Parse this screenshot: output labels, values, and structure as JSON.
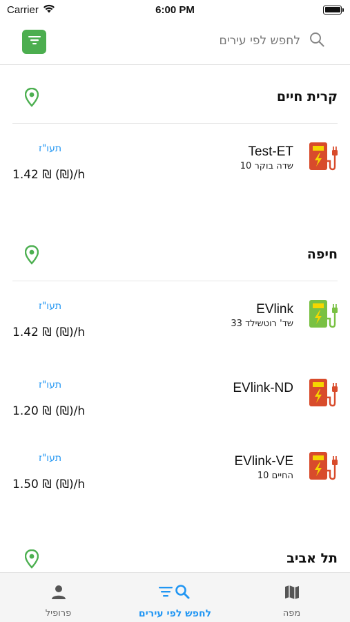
{
  "status_bar": {
    "carrier": "Carrier",
    "time": "6:00 PM"
  },
  "search": {
    "placeholder": "לחפש לפי עירים"
  },
  "cities": [
    {
      "name": "קרית חיים",
      "stations": [
        {
          "name": "Test-ET",
          "address": "שדה בוקר 10",
          "link": "תעו\"ז",
          "price": "1.42 ₪ (₪)/h",
          "status": "busy",
          "color": "#d84b2b"
        }
      ]
    },
    {
      "name": "חיפה",
      "stations": [
        {
          "name": "EVlink",
          "address": "שד' רוטשילד 33",
          "link": "תעו\"ז",
          "price": "1.42 ₪ (₪)/h",
          "status": "available",
          "color": "#79c143"
        },
        {
          "name": "EVlink-ND",
          "address": "",
          "link": "תעו\"ז",
          "price": "1.20 ₪ (₪)/h",
          "status": "busy",
          "color": "#d84b2b"
        },
        {
          "name": "EVlink-VE",
          "address": "החיים 10",
          "link": "תעו\"ז",
          "price": "1.50 ₪ (₪)/h",
          "status": "busy",
          "color": "#d84b2b"
        }
      ]
    },
    {
      "name": "תל אביב",
      "stations": []
    }
  ],
  "tabs": [
    {
      "label": "פרופיל",
      "icon": "person-icon",
      "active": false
    },
    {
      "label": "לחפש לפי עירים",
      "icon": "filter-search-icon",
      "active": true
    },
    {
      "label": "מפה",
      "icon": "map-icon",
      "active": false
    }
  ],
  "colors": {
    "accent": "#2196f3",
    "brand_green": "#4cae4f",
    "pin_green": "#4caf50",
    "charger_busy": "#d84b2b",
    "charger_available": "#79c143"
  }
}
